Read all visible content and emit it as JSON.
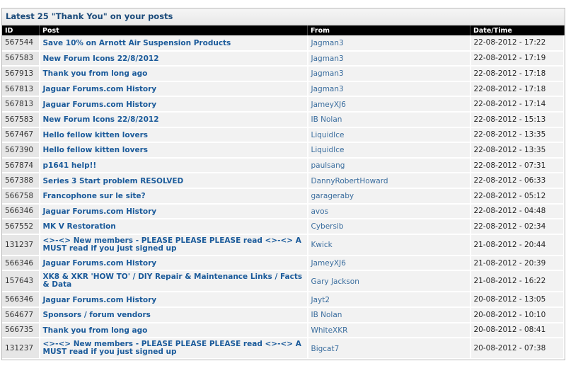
{
  "panel": {
    "title": "Latest 25 \"Thank You\" on your posts"
  },
  "table": {
    "headers": {
      "id": "ID",
      "post": "Post",
      "from": "From",
      "datetime": "Date/Time"
    },
    "rows": [
      {
        "id": "567544",
        "post": "Save 10% on Arnott Air Suspension Products",
        "from": "Jagman3",
        "datetime": "22-08-2012 - 17:22"
      },
      {
        "id": "567583",
        "post": "New Forum Icons 22/8/2012",
        "from": "Jagman3",
        "datetime": "22-08-2012 - 17:19"
      },
      {
        "id": "567913",
        "post": "Thank you from long ago",
        "from": "Jagman3",
        "datetime": "22-08-2012 - 17:18"
      },
      {
        "id": "567813",
        "post": "Jaguar Forums.com History",
        "from": "Jagman3",
        "datetime": "22-08-2012 - 17:18"
      },
      {
        "id": "567813",
        "post": "Jaguar Forums.com History",
        "from": "JameyXJ6",
        "datetime": "22-08-2012 - 17:14"
      },
      {
        "id": "567583",
        "post": "New Forum Icons 22/8/2012",
        "from": "IB Nolan",
        "datetime": "22-08-2012 - 15:13"
      },
      {
        "id": "567467",
        "post": "Hello fellow kitten lovers",
        "from": "LiquidIce",
        "datetime": "22-08-2012 - 13:35"
      },
      {
        "id": "567390",
        "post": "Hello fellow kitten lovers",
        "from": "LiquidIce",
        "datetime": "22-08-2012 - 13:35"
      },
      {
        "id": "567874",
        "post": "p1641 help!!",
        "from": "paulsang",
        "datetime": "22-08-2012 - 07:31"
      },
      {
        "id": "567388",
        "post": "Series 3 Start problem RESOLVED",
        "from": "DannyRobertHoward",
        "datetime": "22-08-2012 - 06:33"
      },
      {
        "id": "566758",
        "post": "Francophone sur le site?",
        "from": "garageraby",
        "datetime": "22-08-2012 - 05:12"
      },
      {
        "id": "566346",
        "post": "Jaguar Forums.com History",
        "from": "avos",
        "datetime": "22-08-2012 - 04:48"
      },
      {
        "id": "567552",
        "post": "MK V Restoration",
        "from": "Cybersib",
        "datetime": "22-08-2012 - 02:34"
      },
      {
        "id": "131237",
        "post": "<>-<> New members - PLEASE PLEASE PLEASE read <>-<> A MUST read if you just signed up",
        "from": "Kwick",
        "datetime": "21-08-2012 - 20:44",
        "tall": true
      },
      {
        "id": "566346",
        "post": "Jaguar Forums.com History",
        "from": "JameyXJ6",
        "datetime": "21-08-2012 - 20:39"
      },
      {
        "id": "157643",
        "post": "XK8 & XKR 'HOW TO' / DIY Repair & Maintenance Links / Facts & Data",
        "from": "Gary Jackson",
        "datetime": "21-08-2012 - 16:22",
        "tall": true
      },
      {
        "id": "566346",
        "post": "Jaguar Forums.com History",
        "from": "Jayt2",
        "datetime": "20-08-2012 - 13:05"
      },
      {
        "id": "564677",
        "post": "Sponsors / forum vendors",
        "from": "IB Nolan",
        "datetime": "20-08-2012 - 10:10"
      },
      {
        "id": "566735",
        "post": "Thank you from long ago",
        "from": "WhiteXKR",
        "datetime": "20-08-2012 - 08:41"
      },
      {
        "id": "131237",
        "post": "<>-<> New members - PLEASE PLEASE PLEASE read <>-<> A MUST read if you just signed up",
        "from": "Bigcat7",
        "datetime": "20-08-2012 - 07:38",
        "tall": true
      }
    ]
  }
}
